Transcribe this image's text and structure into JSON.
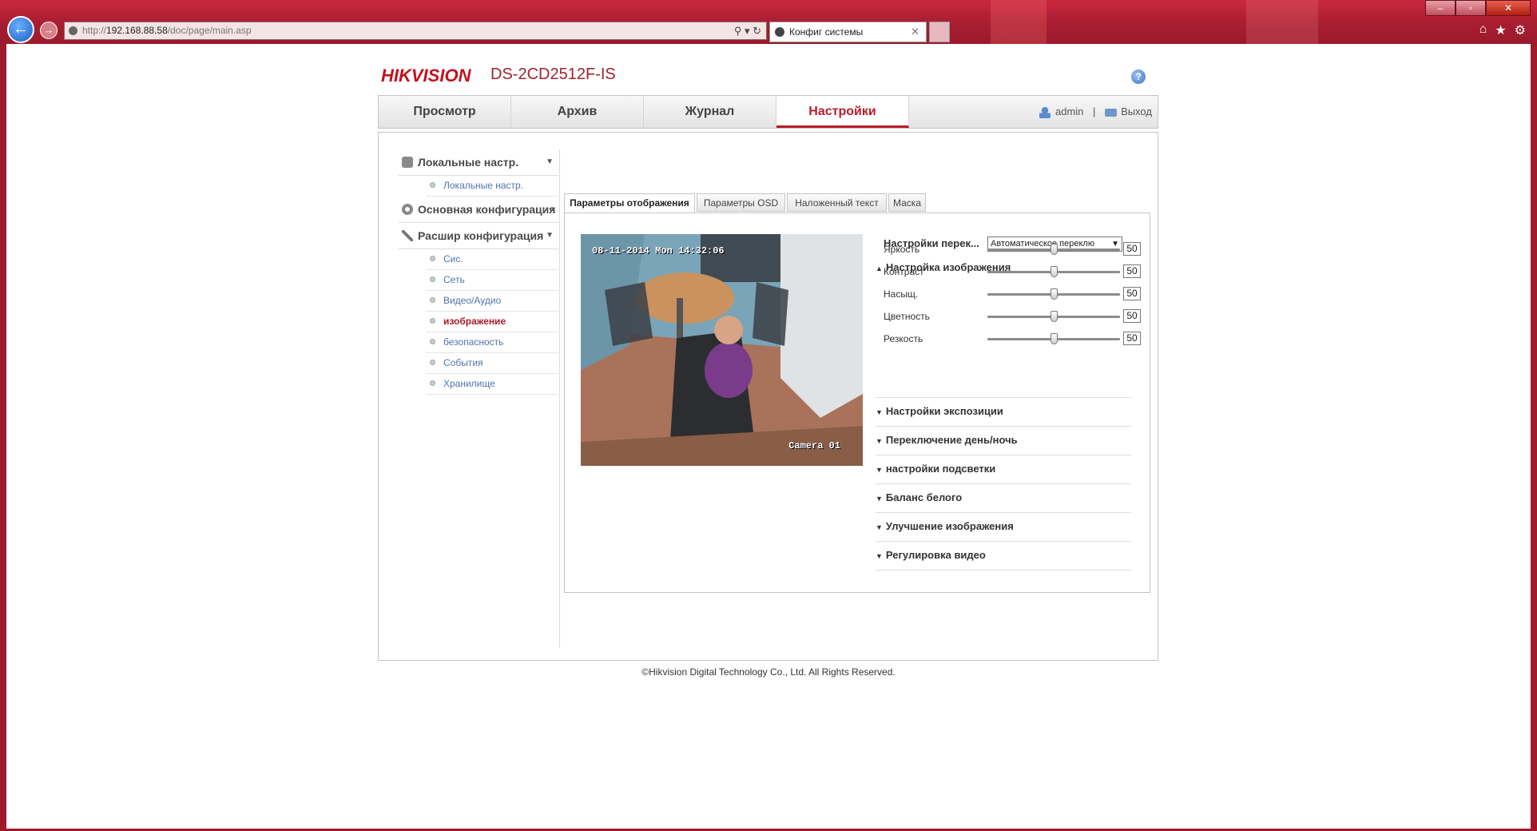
{
  "browser": {
    "url_prefix": "http://",
    "url_host": "192.168.88.58",
    "url_path": "/doc/page/main.asp",
    "tab_title": "Конфиг системы",
    "back_glyph": "←",
    "forward_glyph": "→",
    "close_glyph": "✕",
    "window_buttons": [
      "–",
      "▫",
      "✕"
    ],
    "right_icons": [
      "home-icon",
      "star-icon",
      "gear-icon"
    ]
  },
  "header": {
    "logo": "HIKVISION",
    "model": "DS-2CD2512F-IS",
    "help_glyph": "?"
  },
  "mainnav": {
    "tabs": [
      "Просмотр",
      "Архив",
      "Журнал",
      "Настройки"
    ],
    "active_tab": "Настройки",
    "user": "admin",
    "separator": "|",
    "logout": "Выход"
  },
  "menu": {
    "local": "Локальные настр.",
    "local_items": [
      "Локальные настр."
    ],
    "basic": "Основная конфигурация",
    "advanced": "Расшир конфигурация",
    "advanced_items": [
      "Сис.",
      "Сеть",
      "Видео/Аудио",
      "изображение",
      "безопасность",
      "События",
      "Хранилище"
    ],
    "active_item": "изображение"
  },
  "subtabs": [
    "Параметры отображения",
    "Параметры OSD",
    "Наложенный текст",
    "Маска"
  ],
  "preview": {
    "timestamp": "08-11-2014 Mon 14:32:06",
    "camera": "Camera 01"
  },
  "settings": {
    "switch_label": "Настройки перек...",
    "switch_value": "Автоматическое переклю",
    "image_section": "Настройка изображения",
    "sliders": [
      {
        "label": "Яркость",
        "value": 50
      },
      {
        "label": "Контраст",
        "value": 50
      },
      {
        "label": "Насыщ.",
        "value": 50
      },
      {
        "label": "Цветность",
        "value": 50
      },
      {
        "label": "Резкость",
        "value": 50
      }
    ],
    "sections": [
      "Настройки экспозиции",
      "Переключение день/ночь",
      "настройки подсветки",
      "Баланс белого",
      "Улучшение изображения",
      "Регулировка видео"
    ]
  },
  "footer": "©Hikvision Digital Technology Co., Ltd. All Rights Reserved.",
  "colors": {
    "brand_red": "#c1121f",
    "active_red": "#b81c2a",
    "link_blue": "#4f74ad",
    "window_red": "#a81d31"
  }
}
